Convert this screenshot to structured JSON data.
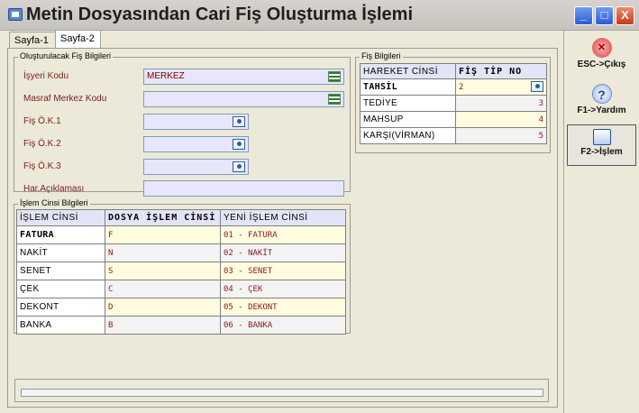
{
  "window": {
    "title": "Metin Dosyasından Cari Fiş Oluşturma İşlemi",
    "minimize": "_",
    "maximize": "□",
    "close": "X"
  },
  "tabs": [
    {
      "label": "Sayfa-1"
    },
    {
      "label": "Sayfa-2"
    }
  ],
  "olusturulacak": {
    "title": "Oluşturulacak Fiş Bilgileri",
    "isyeri_label": "İşyeri Kodu",
    "isyeri_value": "MERKEZ",
    "masraf_label": "Masraf Merkez Kodu",
    "masraf_value": "",
    "ok1_label": "Fiş Ö.K.1",
    "ok1_value": "",
    "ok2_label": "Fiş Ö.K.2",
    "ok2_value": "",
    "ok3_label": "Fiş Ö.K.3",
    "ok3_value": "",
    "aciklama_label": "Har.Açıklaması",
    "aciklama_value": ""
  },
  "fis_bilgileri": {
    "title": "Fiş Bilgileri",
    "headers": [
      "HAREKET CİNSİ",
      "FİŞ TİP NO"
    ],
    "rows": [
      {
        "label": "TAHSİL",
        "value": "2"
      },
      {
        "label": "TEDİYE",
        "value": "3"
      },
      {
        "label": "MAHSUP",
        "value": "4"
      },
      {
        "label": "KARŞI(VİRMAN)",
        "value": "5"
      }
    ]
  },
  "islem_cinsi": {
    "title": "İşlem Cinsi Bilgileri",
    "headers": [
      "İŞLEM CİNSİ",
      "DOSYA İŞLEM CİNSİ",
      "YENİ İŞLEM CİNSİ"
    ],
    "rows": [
      {
        "label": "FATURA",
        "dosya": "F",
        "yeni": "01 - FATURA"
      },
      {
        "label": "NAKİT",
        "dosya": "N",
        "yeni": "02 - NAKİT"
      },
      {
        "label": "SENET",
        "dosya": "S",
        "yeni": "03 - SENET"
      },
      {
        "label": "ÇEK",
        "dosya": "C",
        "yeni": "04 - ÇEK"
      },
      {
        "label": "DEKONT",
        "dosya": "D",
        "yeni": "05 - DEKONT"
      },
      {
        "label": "BANKA",
        "dosya": "B",
        "yeni": "06 - BANKA"
      }
    ]
  },
  "sidebar": {
    "exit_label": "ESC->Çıkış",
    "help_label": "F1->Yardım",
    "process_label": "F2->İşlem"
  },
  "colors": {
    "field_bg": "#e7e6fa",
    "value_text": "#800000",
    "cell_bg": "#fffcdf"
  }
}
